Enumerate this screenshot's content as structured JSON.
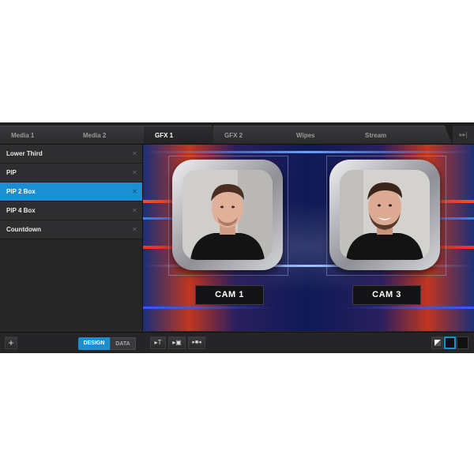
{
  "tabs": [
    {
      "label": "Media 1",
      "active": false
    },
    {
      "label": "Media 2",
      "active": false
    },
    {
      "label": "GFX 1",
      "active": true
    },
    {
      "label": "GFX 2",
      "active": false
    },
    {
      "label": "Wipes",
      "active": false
    },
    {
      "label": "Stream",
      "active": false
    }
  ],
  "tab_end_icon": "skip-end-icon",
  "tab_end_glyph": "▸▸|",
  "sidebar": {
    "items": [
      {
        "label": "Lower Third",
        "selected": false
      },
      {
        "label": "PIP",
        "selected": false
      },
      {
        "label": "PIP 2 Box",
        "selected": true
      },
      {
        "label": "PIP 4 Box",
        "selected": false
      },
      {
        "label": "Countdown",
        "selected": false
      }
    ],
    "remove_glyph": "✕"
  },
  "canvas": {
    "cam_left_label": "CAM 1",
    "cam_right_label": "CAM 3"
  },
  "bottom": {
    "add_glyph": "+",
    "design_label": "DESIGN",
    "data_label": "DATA",
    "tools": [
      "text-tool-icon",
      "image-tool-icon",
      "video-tool-icon"
    ],
    "text_tool_glyph": "▸T",
    "image_tool_glyph": "▸▣",
    "video_tool_glyph": "▸■◂"
  },
  "colors": {
    "accent": "#1c8fd2",
    "panel": "#2e2e30"
  }
}
